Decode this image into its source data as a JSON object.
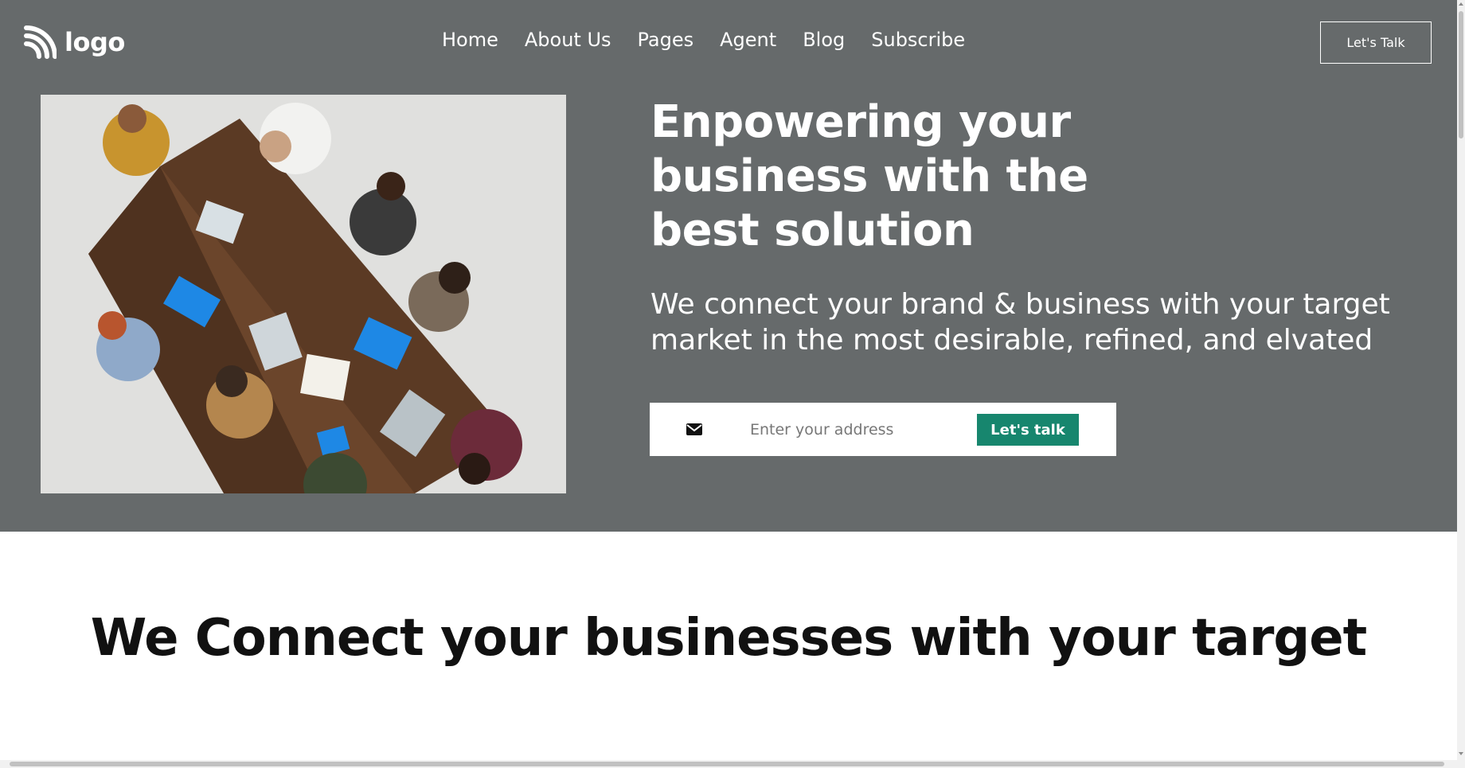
{
  "header": {
    "logo_text": "logo",
    "nav": [
      "Home",
      "About Us",
      "Pages",
      "Agent",
      "Blog",
      "Subscribe"
    ],
    "cta_label": "Let's Talk"
  },
  "hero": {
    "title": "Enpowering your business with the best solution",
    "subtitle": "We connect your brand & business with your target market in the most desirable, refined, and elvated",
    "form": {
      "placeholder": "Enter your address",
      "button_label": "Let's talk",
      "icon": "envelope-icon"
    }
  },
  "section": {
    "title": "We Connect your businesses with your target"
  },
  "colors": {
    "hero_bg": "#666a6b",
    "accent": "#17866e",
    "text_light": "#ffffff",
    "text_dark": "#111111"
  }
}
